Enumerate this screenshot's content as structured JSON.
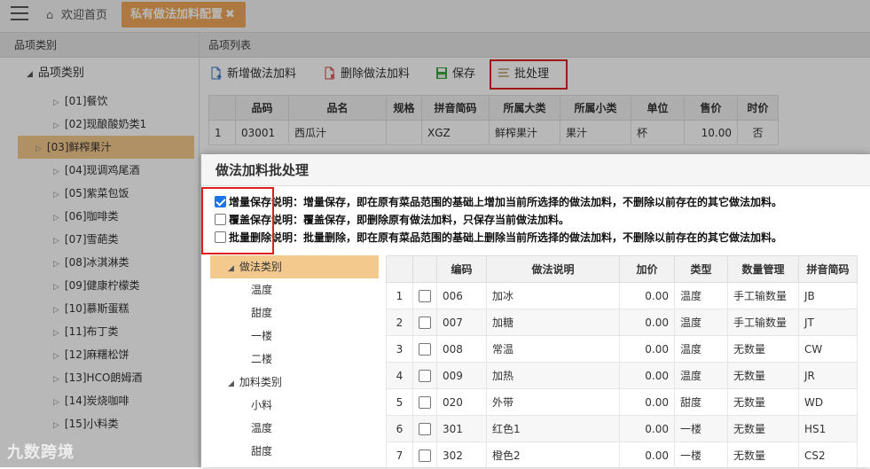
{
  "tabs": {
    "home": "欢迎首页",
    "active": "私有做法加料配置"
  },
  "left": {
    "header": "品项类别",
    "root": "品项类别",
    "items": [
      "[01]餐饮",
      "[02]现酿酸奶类1",
      "[03]鲜榨果汁",
      "[04]现调鸡尾酒",
      "[05]紫菜包饭",
      "[06]咖啡类",
      "[07]雪葩类",
      "[08]冰淇淋类",
      "[09]健康柠檬类",
      "[10]慕斯蛋糕",
      "[11]布丁类",
      "[12]麻糬松饼",
      "[13]HCO朗姆酒",
      "[14]炭烧咖啡",
      "[15]小料类"
    ]
  },
  "right": {
    "header": "品项列表",
    "toolbar": {
      "add": "新增做法加料",
      "delete": "删除做法加料",
      "save": "保存",
      "batch": "批处理"
    },
    "columns": [
      "",
      "品码",
      "品名",
      "规格",
      "拼音简码",
      "所属大类",
      "所属小类",
      "单位",
      "售价",
      "时价"
    ],
    "rows": [
      [
        "1",
        "03001",
        "西瓜汁",
        "",
        "XGZ",
        "鲜榨果汁",
        "果汁",
        "杯",
        "10.00",
        "否"
      ]
    ]
  },
  "dialog": {
    "title": "做法加料批处理",
    "options": [
      {
        "label": "增量保存",
        "checked": true,
        "desc": "说明：增量保存，即在原有菜品范围的基础上增加当前所选择的做法加料，不删除以前存在的其它做法加料。"
      },
      {
        "label": "覆盖保存",
        "checked": false,
        "desc": "说明：覆盖保存，即删除原有做法加料，只保存当前做法加料。"
      },
      {
        "label": "批量删除",
        "checked": false,
        "desc": "说明：批量删除，即在原有菜品范围的基础上删除当前所选择的做法加料，不删除以前存在的其它做法加料。"
      }
    ],
    "tree": [
      {
        "type": "cat",
        "label": "做法类别"
      },
      {
        "type": "leaf",
        "label": "温度"
      },
      {
        "type": "leaf",
        "label": "甜度"
      },
      {
        "type": "leaf",
        "label": "一楼"
      },
      {
        "type": "leaf",
        "label": "二楼"
      },
      {
        "type": "cat",
        "label": "加料类别"
      },
      {
        "type": "leaf",
        "label": "小料"
      },
      {
        "type": "leaf",
        "label": "温度"
      },
      {
        "type": "leaf",
        "label": "甜度"
      }
    ],
    "columns": [
      "",
      "",
      "编码",
      "做法说明",
      "加价",
      "类型",
      "数量管理",
      "拼音简码"
    ],
    "rows": [
      [
        "1",
        "006",
        "加冰",
        "0.00",
        "温度",
        "手工输数量",
        "JB"
      ],
      [
        "2",
        "007",
        "加糖",
        "0.00",
        "温度",
        "手工输数量",
        "JT"
      ],
      [
        "3",
        "008",
        "常温",
        "0.00",
        "温度",
        "无数量",
        "CW"
      ],
      [
        "4",
        "009",
        "加热",
        "0.00",
        "温度",
        "无数量",
        "JR"
      ],
      [
        "5",
        "020",
        "外带",
        "0.00",
        "甜度",
        "无数量",
        "WD"
      ],
      [
        "6",
        "301",
        "红色1",
        "0.00",
        "一楼",
        "无数量",
        "HS1"
      ],
      [
        "7",
        "302",
        "橙色2",
        "0.00",
        "一楼",
        "无数量",
        "CS2"
      ]
    ]
  },
  "watermark": "九数跨境"
}
